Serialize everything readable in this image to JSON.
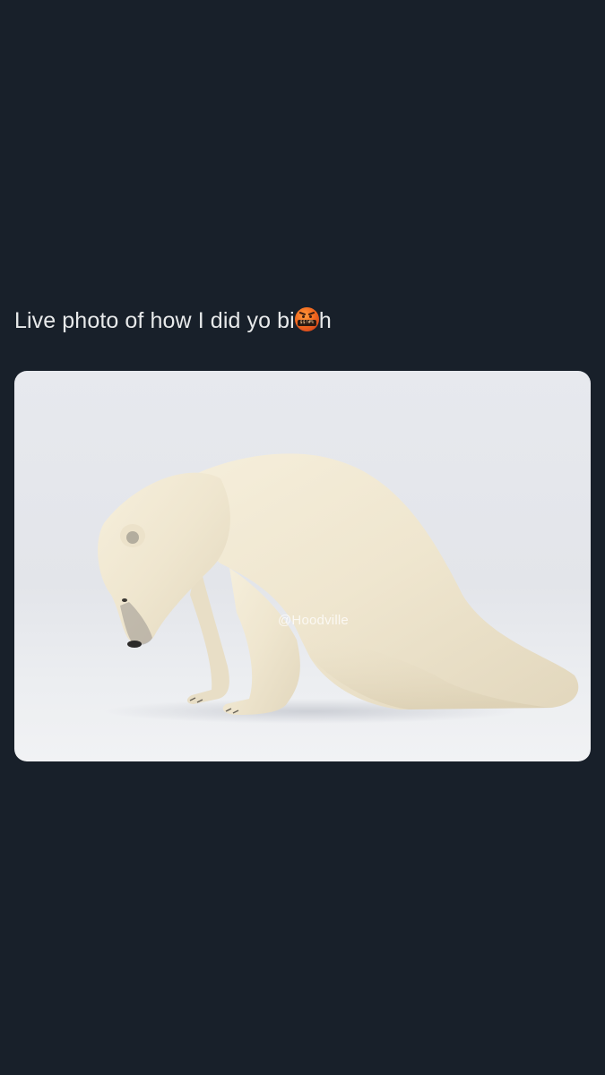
{
  "post": {
    "text_prefix": "Live photo of how I did yo bi",
    "text_suffix": "h",
    "censor_emoji": {
      "icon": "face-with-symbols-on-mouth-emoji",
      "symbols": "$$!#%",
      "color": "#f26a1f"
    }
  },
  "media": {
    "watermark": "@Hoodville",
    "background_color": "#e6e8ec",
    "subject_color": "#f2ead6"
  },
  "theme": {
    "background": "#18202a",
    "text_color": "#e7e9ea"
  }
}
